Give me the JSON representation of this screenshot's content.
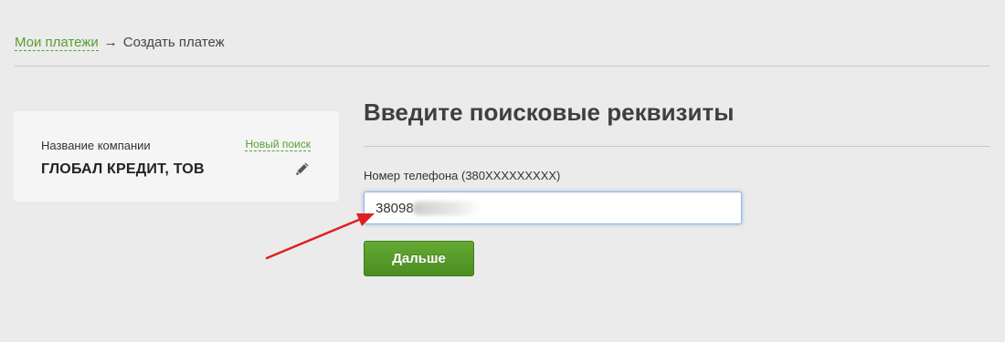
{
  "breadcrumb": {
    "parent_label": "Мои платежи",
    "separator": "→",
    "current_label": "Создать платеж"
  },
  "company_card": {
    "label": "Название компании",
    "new_search_label": "Новый поиск",
    "name": "ГЛОБАЛ КРЕДИТ, ТОВ",
    "edit_icon": "pencil-icon"
  },
  "form": {
    "title": "Введите поисковые реквизиты",
    "phone_label": "Номер телефона (380XXXXXXXXX)",
    "phone_value": "38098",
    "next_button_label": "Дальше"
  },
  "colors": {
    "background": "#ebebeb",
    "accent_green": "#5a9e2f",
    "button_green": "#4a8d22",
    "annotation_red": "#e02020",
    "input_focus_blue": "#8fb8dd"
  }
}
